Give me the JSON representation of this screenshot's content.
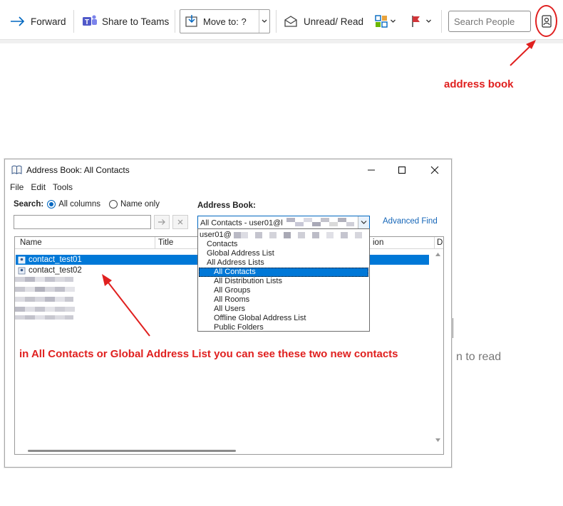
{
  "ribbon": {
    "forward_label": "Forward",
    "share_teams_label": "Share to Teams",
    "move_to_label": "Move to: ?",
    "unread_read_label": "Unread/ Read",
    "search_people_placeholder": "Search People",
    "colors": {
      "accent": "#0067c0",
      "teams": "#5059c9",
      "flag": "#d13438"
    }
  },
  "annotations": {
    "address_book_note": "address book",
    "contacts_note": "in All Contacts or Global Address List you can see these two new contacts",
    "color": "#e0201f"
  },
  "dialog": {
    "title": "Address Book: All Contacts",
    "menu": [
      "File",
      "Edit",
      "Tools"
    ],
    "search_label": "Search:",
    "all_columns_label": "All columns",
    "name_only_label": "Name only",
    "search_mode_selected": "All columns",
    "search_value": "",
    "address_book_label": "Address Book:",
    "combo_value": "All Contacts - user01@l",
    "advanced_find_label": "Advanced Find",
    "columns": [
      "Name",
      "Title",
      "ion",
      "D"
    ],
    "contacts": [
      "contact_test01",
      "contact_test02"
    ],
    "selected_contact": "contact_test01",
    "dropdown": {
      "items": [
        "user01@",
        "Contacts",
        "Global Address List",
        "All Address Lists",
        "All Contacts",
        "All Distribution Lists",
        "All Groups",
        "All Rooms",
        "All Users",
        "Offline Global Address List",
        "Public Folders"
      ],
      "selected": "All Contacts"
    }
  },
  "background": {
    "reading_pane_text": "n to read"
  }
}
